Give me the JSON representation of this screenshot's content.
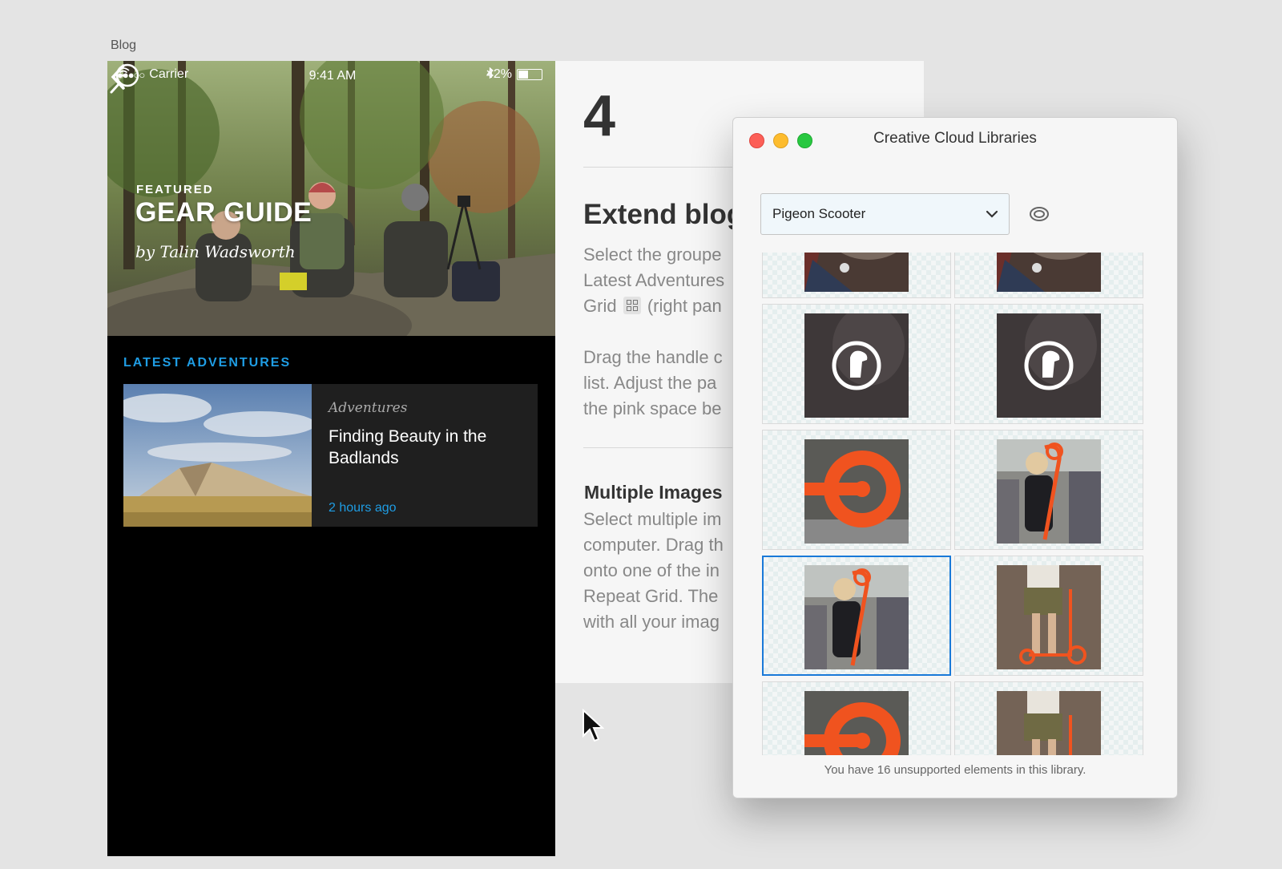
{
  "artboard_label": "Blog",
  "phone": {
    "status": {
      "carrier": "Carrier",
      "time": "9:41 AM",
      "battery": "42%",
      "signal": "●●●○○"
    },
    "hero": {
      "eyebrow": "FEATURED",
      "title": "GEAR GUIDE",
      "byline": "by Talin Wadsworth"
    },
    "section_title": "LATEST ADVENTURES",
    "card": {
      "category": "Adventures",
      "title": "Finding Beauty in the Badlands",
      "time": "2 hours ago"
    }
  },
  "panel": {
    "step_number": "4",
    "heading": "Extend blog",
    "para1": [
      "Select the groupe",
      "Latest Adventures",
      "(right pan"
    ],
    "para1_grid_prefix": "Grid",
    "para2": [
      "Drag the handle c",
      "list. Adjust the pa",
      "the pink space be"
    ],
    "subheading": "Multiple Images",
    "para3": [
      "Select multiple im",
      "computer. Drag th",
      "onto one of the in",
      "Repeat Grid. The",
      "with all your imag"
    ]
  },
  "cc_window": {
    "title": "Creative Cloud Libraries",
    "library": "Pigeon Scooter",
    "footer": "You have 16 unsupported elements in this library.",
    "items": [
      "hair",
      "hair",
      "pigeon-logo",
      "pigeon-logo",
      "wheel",
      "woman-scooter",
      "woman-scooter",
      "legs-scooter",
      "wheel",
      "legs-scooter"
    ],
    "selected_index": 6
  },
  "colors": {
    "accent": "#1f9de4",
    "selection": "#1979d8",
    "card_bg": "#1f1f1f",
    "scooter_orange": "#f0531f"
  }
}
